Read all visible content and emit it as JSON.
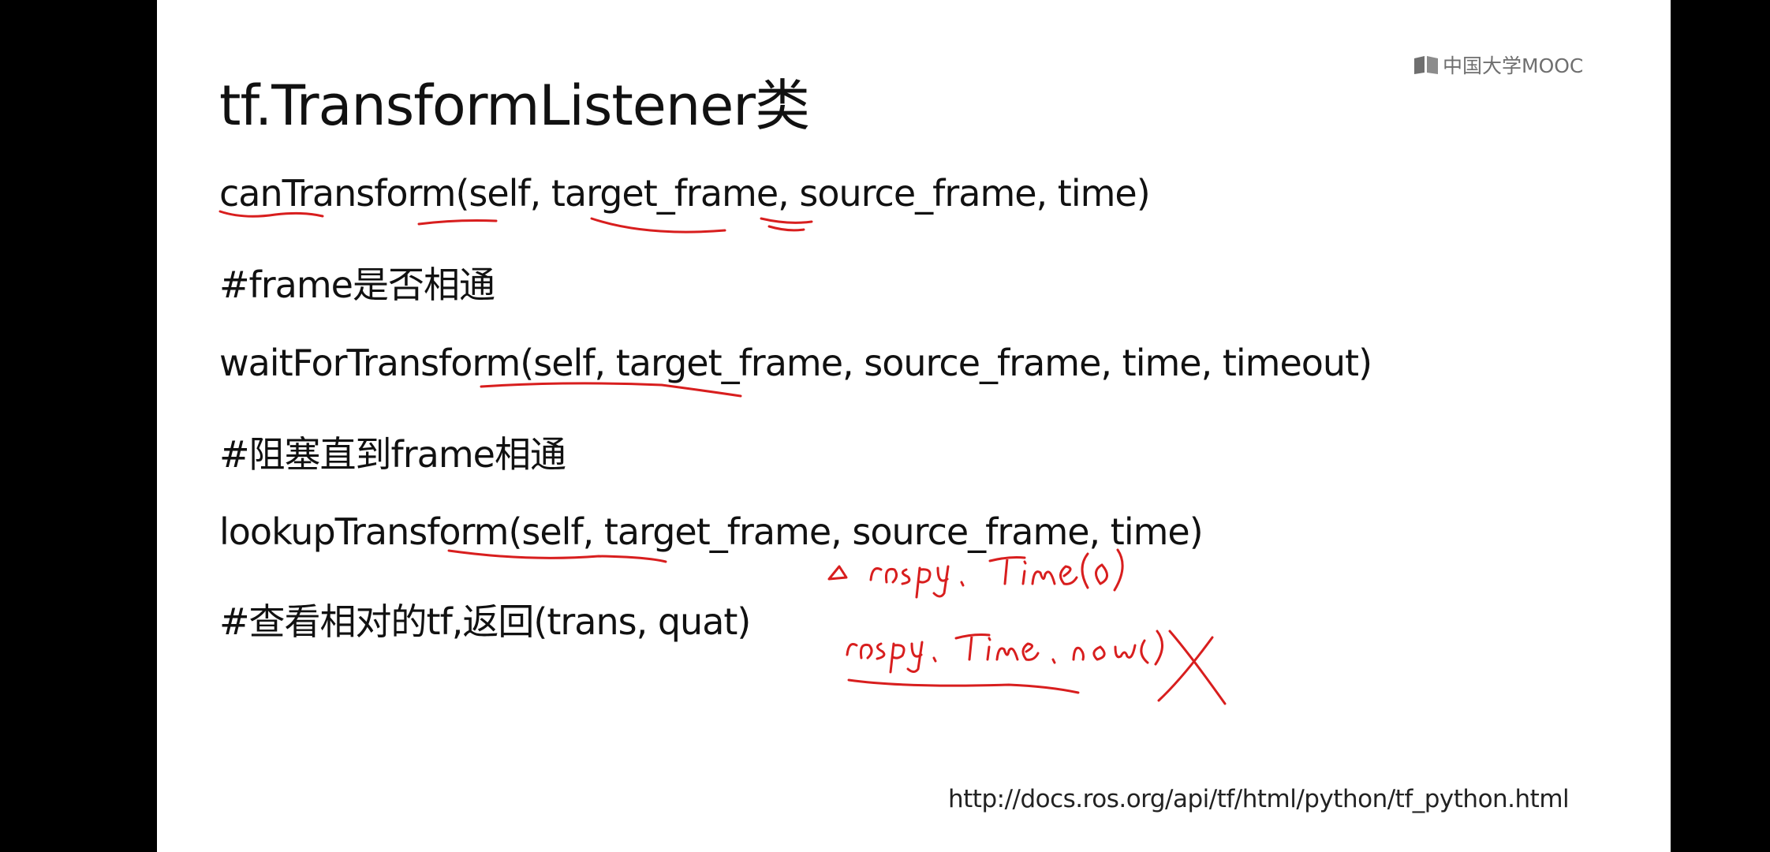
{
  "logo": {
    "text": "中国大学MOOC",
    "icon": "book-icon",
    "color": "#6f6f6f"
  },
  "slide": {
    "title": "tf.TransformListener类",
    "lines": [
      "canTransform(self, target_frame, source_frame, time)",
      "#frame是否相通",
      "waitForTransform(self, target_frame, source_frame, time, timeout)",
      "#阻塞直到frame相通",
      "lookupTransform(self, target_frame, source_frame, time)",
      "#查看相对的tf,返回(trans, quat)"
    ],
    "url": "http://docs.ros.org/api/tf/html/python/tf_python.html"
  },
  "annotations": {
    "note_1": "rospy.Time(0)",
    "note_2": "rospy.Time.now()",
    "ink_color": "#d81e1e"
  }
}
